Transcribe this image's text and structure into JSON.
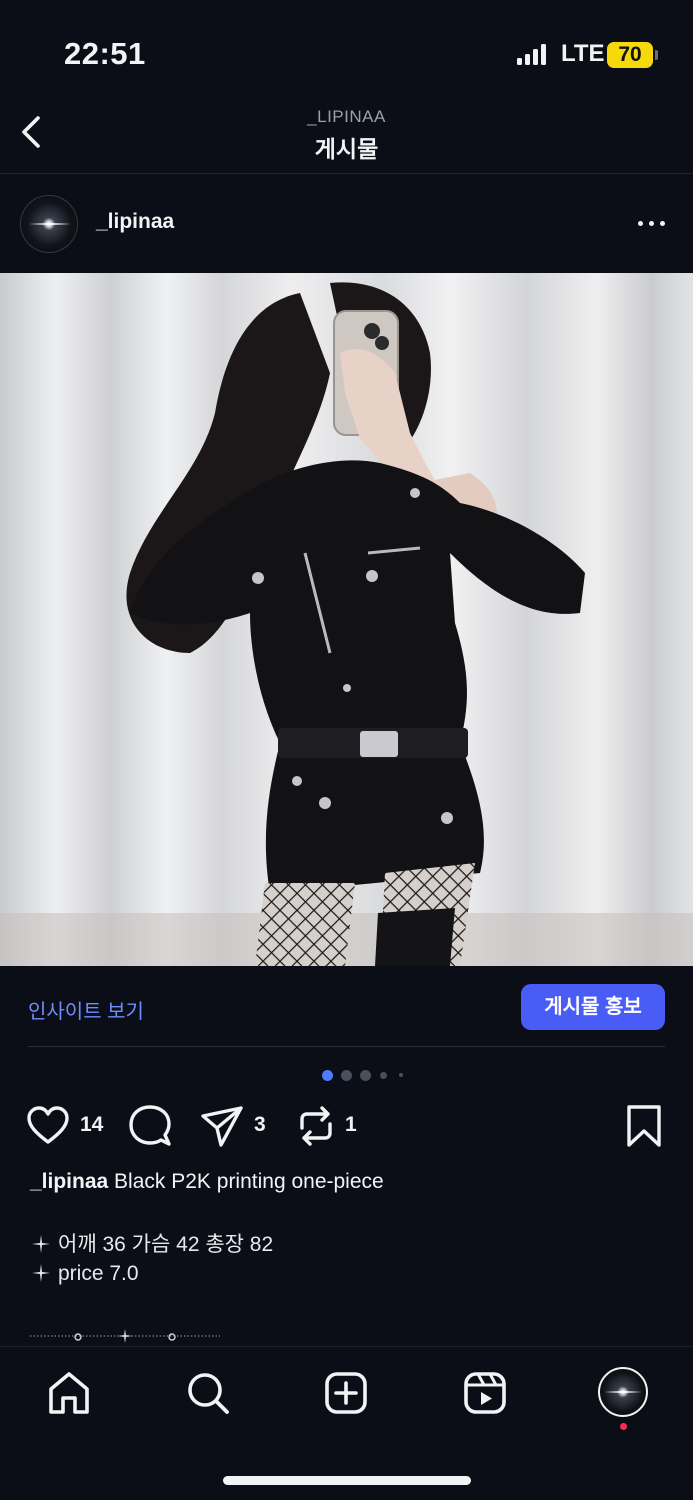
{
  "status_bar": {
    "time": "22:51",
    "network": "LTE",
    "battery": "70"
  },
  "header": {
    "subtitle": "_LIPINAA",
    "title": "게시물"
  },
  "post": {
    "username": "_lipinaa"
  },
  "insights": {
    "link_label": "인사이트 보기",
    "promote_label": "게시물 홍보"
  },
  "carousel": {
    "count": 5,
    "active_index": 0
  },
  "actions": {
    "likes": "14",
    "shares": "3",
    "reposts": "1"
  },
  "caption": {
    "username": "_lipinaa",
    "text": "Black P2K printing one-piece",
    "line1": "어깨 36 가슴 42 총장 82",
    "line2": "price 7.0"
  },
  "colors": {
    "accent": "#4a5cf6",
    "link": "#6f8cff",
    "background": "#0b0e17",
    "battery": "#f5d90a",
    "notification": "#ff2d48"
  },
  "icons": [
    "back-icon",
    "more-icon",
    "heart-icon",
    "comment-icon",
    "send-icon",
    "repost-icon",
    "bookmark-icon",
    "home-icon",
    "search-icon",
    "create-icon",
    "reels-icon"
  ]
}
